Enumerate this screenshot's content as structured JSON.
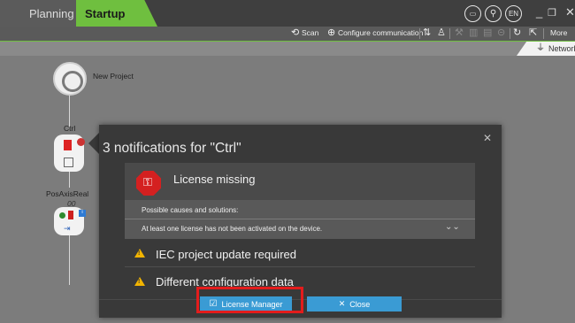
{
  "tabs": {
    "planning": "Planning",
    "startup": "Startup"
  },
  "header_icons": {
    "chat": "chat-icon",
    "search": "search-icon",
    "language": "EN"
  },
  "toolbar": {
    "scan": "Scan",
    "configure": "Configure communication",
    "more": "More"
  },
  "network_tab": "Network",
  "tree": {
    "project": "New Project",
    "ctrl": "Ctrl",
    "axis": "PosAxisReal",
    "axis_sub": "00"
  },
  "dialog": {
    "title": "3 notifications for \"Ctrl\"",
    "license_title": "License missing",
    "causes_label": "Possible causes and solutions:",
    "solution": "At least one license has not been activated on the device.",
    "notifications": [
      "IEC project update required",
      "Different configuration data"
    ],
    "license_manager": "License Manager",
    "close": "Close"
  },
  "colors": {
    "accent": "#6fbf3f",
    "button": "#3a9bd4",
    "highlight": "#e31c1c",
    "error": "#d42020",
    "warning": "#f2b400"
  }
}
